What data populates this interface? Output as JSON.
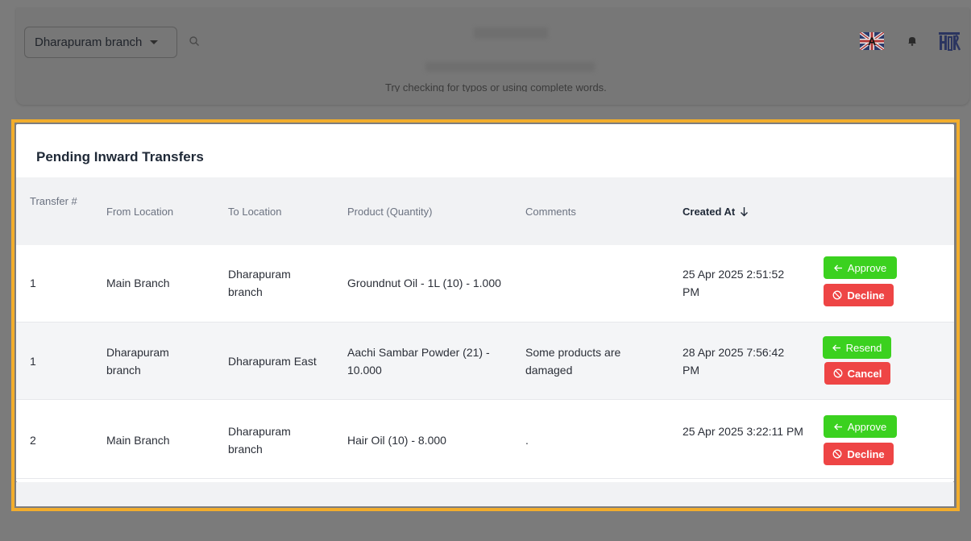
{
  "header": {
    "branch_select": "Dharapuram branch",
    "icons": [
      "search-icon",
      "flag-icon",
      "bell-icon",
      "avatar"
    ],
    "hint_text": "Try checking for typos or using complete words."
  },
  "panel": {
    "title": "Pending Inward Transfers",
    "columns": {
      "transfer": "Transfer #",
      "from": "From Location",
      "to": "To Location",
      "product": "Product (Quantity)",
      "comments": "Comments",
      "created": "Created At"
    },
    "rows": [
      {
        "transfer": "1",
        "from": "Main Branch",
        "to": "Dharapuram branch",
        "product": "Groundnut Oil - 1L (10) - 1.000",
        "comments": "",
        "created": "25 Apr 2025 2:51:52 PM",
        "action_primary": "Approve",
        "action_secondary": "Decline"
      },
      {
        "transfer": "1",
        "from": "Dharapuram branch",
        "to": "Dharapuram East",
        "product": "Aachi Sambar Powder (21) - 10.000",
        "comments": "Some products are damaged",
        "created": "28 Apr 2025 7:56:42 PM",
        "action_primary": "Resend",
        "action_secondary": "Cancel"
      },
      {
        "transfer": "2",
        "from": "Main Branch",
        "to": "Dharapuram branch",
        "product": "Hair Oil (10) - 8.000",
        "comments": ".",
        "created": "25 Apr 2025 3:22:11 PM",
        "action_primary": "Approve",
        "action_secondary": "Decline"
      }
    ]
  },
  "colors": {
    "highlight_border": "#f2ad2c",
    "approve_green": "#3bd11f",
    "decline_red": "#ee4545",
    "overlay_gray": "#7b7b7b"
  }
}
